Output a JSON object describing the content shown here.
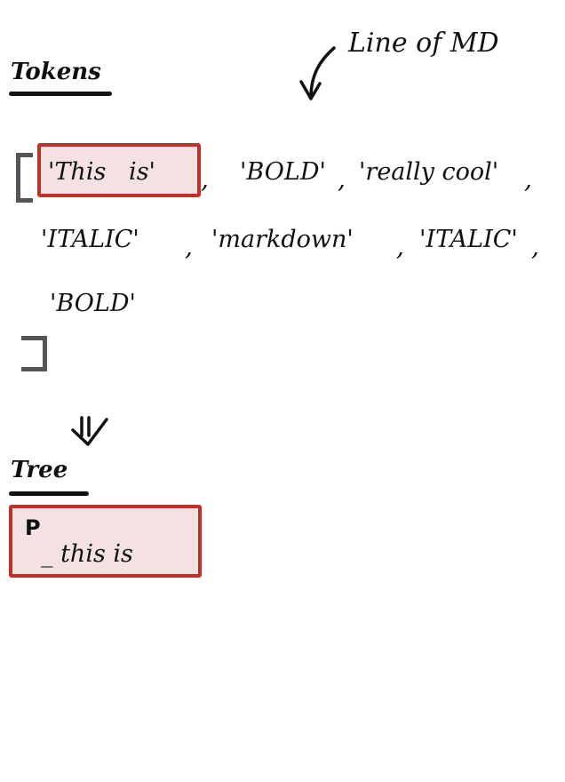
{
  "annotation": {
    "text": "Line of MD"
  },
  "tokens_section": {
    "heading": "Tokens",
    "highlighted_token": "'This   is'",
    "items": [
      "'BOLD'",
      "'really cool'",
      "'ITALIC'",
      "'markdown'",
      "'ITALIC'",
      "'BOLD'"
    ],
    "separator": ","
  },
  "tree_section": {
    "heading": "Tree",
    "node_label": "P",
    "child_text": "_ this is"
  },
  "colors": {
    "ink": "#111111",
    "bracket": "#555555",
    "highlight_border": "#c0302b",
    "highlight_fill": "#f4e1e1"
  }
}
